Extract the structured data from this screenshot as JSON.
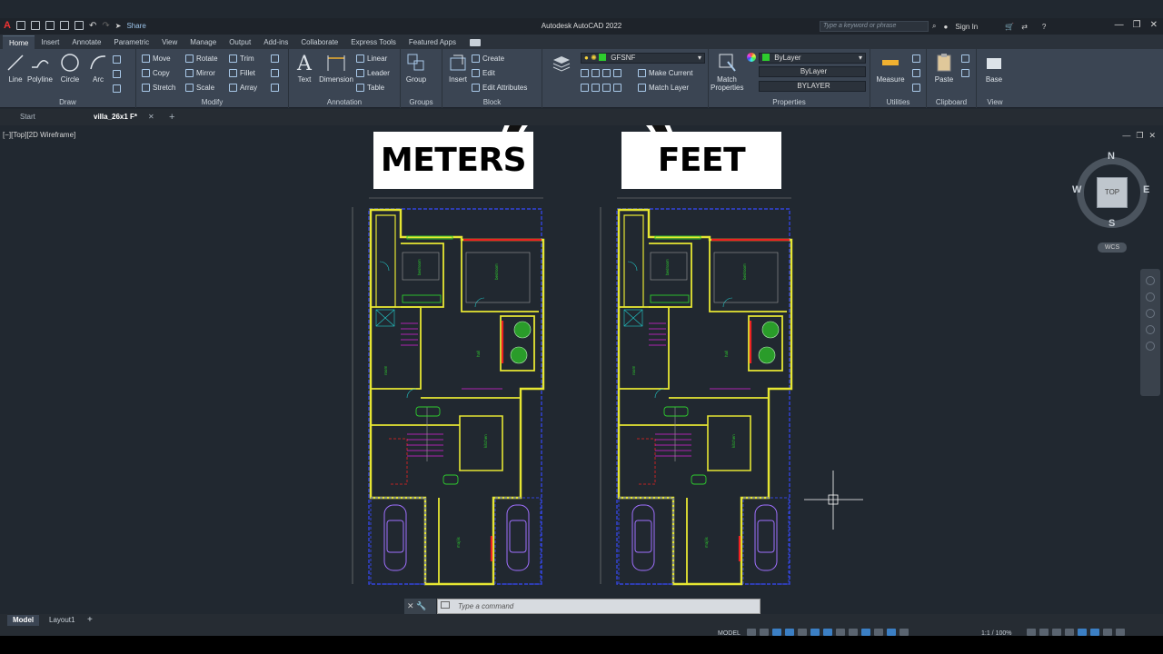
{
  "app": {
    "title": "Autodesk AutoCAD 2022",
    "share": "Share",
    "search_placeholder": "Type a keyword or phrase",
    "sign_in": "Sign In"
  },
  "ribbon_tabs": [
    "Home",
    "Insert",
    "Annotate",
    "Parametric",
    "View",
    "Manage",
    "Output",
    "Add-ins",
    "Collaborate",
    "Express Tools",
    "Featured Apps"
  ],
  "panels": {
    "draw": {
      "title": "Draw",
      "line": "Line",
      "polyline": "Polyline",
      "circle": "Circle",
      "arc": "Arc"
    },
    "modify": {
      "title": "Modify",
      "move": "Move",
      "rotate": "Rotate",
      "trim": "Trim",
      "copy": "Copy",
      "mirror": "Mirror",
      "fillet": "Fillet",
      "stretch": "Stretch",
      "scale": "Scale",
      "array": "Array"
    },
    "annotation": {
      "title": "Annotation",
      "text": "Text",
      "dimension": "Dimension",
      "linear": "Linear",
      "leader": "Leader",
      "table": "Table"
    },
    "groups": {
      "title": "Groups",
      "group": "Group"
    },
    "block": {
      "title": "Block",
      "insert": "Insert",
      "create": "Create",
      "edit": "Edit",
      "edit_attributes": "Edit Attributes"
    },
    "layers": {
      "current_layer": "GFSNF",
      "make_current": "Make Current",
      "match_layer": "Match Layer"
    },
    "properties": {
      "title": "Properties",
      "match_properties_1": "Match",
      "match_properties_2": "Properties",
      "color": "ByLayer",
      "linetype": "ByLayer",
      "lineweight": "BYLAYER"
    },
    "utilities": {
      "title": "Utilities",
      "measure": "Measure"
    },
    "clipboard": {
      "title": "Clipboard",
      "paste": "Paste"
    },
    "view": {
      "title": "View",
      "base": "Base"
    }
  },
  "file_tabs": {
    "start": "Start",
    "current": "villa_26x1 F*"
  },
  "viewport": {
    "label": "[−][Top][2D Wireframe]"
  },
  "banners": {
    "left": "METERS",
    "right": "FEET"
  },
  "viewcube": {
    "north": "N",
    "south": "S",
    "east": "E",
    "west": "W",
    "top": "TOP",
    "wcs": "WCS"
  },
  "command": {
    "placeholder": "Type a command"
  },
  "status": {
    "model_tab": "Model",
    "layout_tab": "Layout1",
    "model_label": "MODEL",
    "scale": "1:1 / 100%"
  }
}
